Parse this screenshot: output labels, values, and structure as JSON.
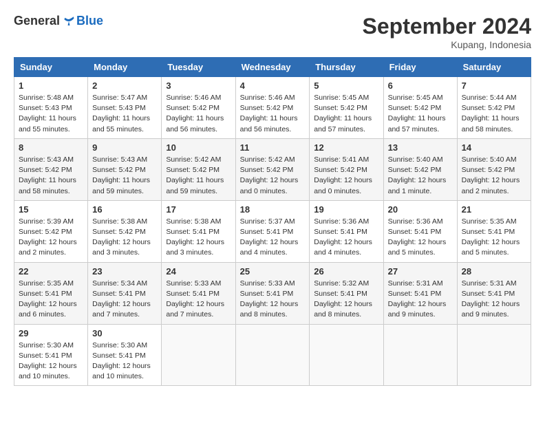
{
  "header": {
    "logo_general": "General",
    "logo_blue": "Blue",
    "month_title": "September 2024",
    "location": "Kupang, Indonesia"
  },
  "days_of_week": [
    "Sunday",
    "Monday",
    "Tuesday",
    "Wednesday",
    "Thursday",
    "Friday",
    "Saturday"
  ],
  "weeks": [
    [
      {
        "day": "1",
        "sunrise": "5:48 AM",
        "sunset": "5:43 PM",
        "daylight": "11 hours and 55 minutes."
      },
      {
        "day": "2",
        "sunrise": "5:47 AM",
        "sunset": "5:43 PM",
        "daylight": "11 hours and 55 minutes."
      },
      {
        "day": "3",
        "sunrise": "5:46 AM",
        "sunset": "5:42 PM",
        "daylight": "11 hours and 56 minutes."
      },
      {
        "day": "4",
        "sunrise": "5:46 AM",
        "sunset": "5:42 PM",
        "daylight": "11 hours and 56 minutes."
      },
      {
        "day": "5",
        "sunrise": "5:45 AM",
        "sunset": "5:42 PM",
        "daylight": "11 hours and 57 minutes."
      },
      {
        "day": "6",
        "sunrise": "5:45 AM",
        "sunset": "5:42 PM",
        "daylight": "11 hours and 57 minutes."
      },
      {
        "day": "7",
        "sunrise": "5:44 AM",
        "sunset": "5:42 PM",
        "daylight": "11 hours and 58 minutes."
      }
    ],
    [
      {
        "day": "8",
        "sunrise": "5:43 AM",
        "sunset": "5:42 PM",
        "daylight": "11 hours and 58 minutes."
      },
      {
        "day": "9",
        "sunrise": "5:43 AM",
        "sunset": "5:42 PM",
        "daylight": "11 hours and 59 minutes."
      },
      {
        "day": "10",
        "sunrise": "5:42 AM",
        "sunset": "5:42 PM",
        "daylight": "11 hours and 59 minutes."
      },
      {
        "day": "11",
        "sunrise": "5:42 AM",
        "sunset": "5:42 PM",
        "daylight": "12 hours and 0 minutes."
      },
      {
        "day": "12",
        "sunrise": "5:41 AM",
        "sunset": "5:42 PM",
        "daylight": "12 hours and 0 minutes."
      },
      {
        "day": "13",
        "sunrise": "5:40 AM",
        "sunset": "5:42 PM",
        "daylight": "12 hours and 1 minute."
      },
      {
        "day": "14",
        "sunrise": "5:40 AM",
        "sunset": "5:42 PM",
        "daylight": "12 hours and 2 minutes."
      }
    ],
    [
      {
        "day": "15",
        "sunrise": "5:39 AM",
        "sunset": "5:42 PM",
        "daylight": "12 hours and 2 minutes."
      },
      {
        "day": "16",
        "sunrise": "5:38 AM",
        "sunset": "5:42 PM",
        "daylight": "12 hours and 3 minutes."
      },
      {
        "day": "17",
        "sunrise": "5:38 AM",
        "sunset": "5:41 PM",
        "daylight": "12 hours and 3 minutes."
      },
      {
        "day": "18",
        "sunrise": "5:37 AM",
        "sunset": "5:41 PM",
        "daylight": "12 hours and 4 minutes."
      },
      {
        "day": "19",
        "sunrise": "5:36 AM",
        "sunset": "5:41 PM",
        "daylight": "12 hours and 4 minutes."
      },
      {
        "day": "20",
        "sunrise": "5:36 AM",
        "sunset": "5:41 PM",
        "daylight": "12 hours and 5 minutes."
      },
      {
        "day": "21",
        "sunrise": "5:35 AM",
        "sunset": "5:41 PM",
        "daylight": "12 hours and 5 minutes."
      }
    ],
    [
      {
        "day": "22",
        "sunrise": "5:35 AM",
        "sunset": "5:41 PM",
        "daylight": "12 hours and 6 minutes."
      },
      {
        "day": "23",
        "sunrise": "5:34 AM",
        "sunset": "5:41 PM",
        "daylight": "12 hours and 7 minutes."
      },
      {
        "day": "24",
        "sunrise": "5:33 AM",
        "sunset": "5:41 PM",
        "daylight": "12 hours and 7 minutes."
      },
      {
        "day": "25",
        "sunrise": "5:33 AM",
        "sunset": "5:41 PM",
        "daylight": "12 hours and 8 minutes."
      },
      {
        "day": "26",
        "sunrise": "5:32 AM",
        "sunset": "5:41 PM",
        "daylight": "12 hours and 8 minutes."
      },
      {
        "day": "27",
        "sunrise": "5:31 AM",
        "sunset": "5:41 PM",
        "daylight": "12 hours and 9 minutes."
      },
      {
        "day": "28",
        "sunrise": "5:31 AM",
        "sunset": "5:41 PM",
        "daylight": "12 hours and 9 minutes."
      }
    ],
    [
      {
        "day": "29",
        "sunrise": "5:30 AM",
        "sunset": "5:41 PM",
        "daylight": "12 hours and 10 minutes."
      },
      {
        "day": "30",
        "sunrise": "5:30 AM",
        "sunset": "5:41 PM",
        "daylight": "12 hours and 10 minutes."
      },
      null,
      null,
      null,
      null,
      null
    ]
  ]
}
